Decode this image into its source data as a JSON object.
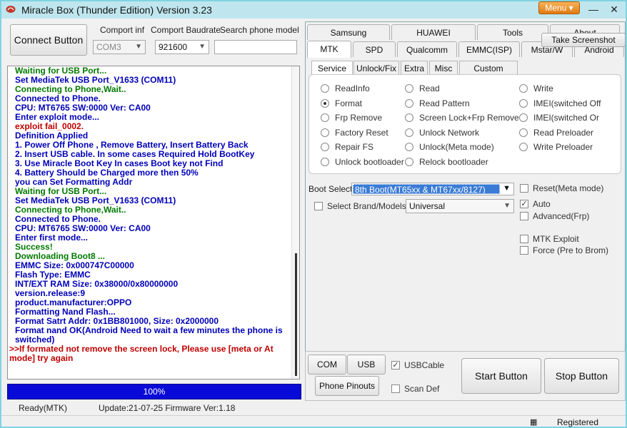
{
  "window": {
    "title": "Miracle Box (Thunder Edition) Version 3.23",
    "menu_label": "Menu",
    "minimize": "—",
    "close": "✕"
  },
  "toolbar": {
    "connect_label": "Connect Button",
    "comport_label": "Comport inf",
    "comport_value": "COM3",
    "baudrate_label": "Comport Baudrate",
    "baudrate_value": "921600",
    "search_label": "Search phone model",
    "search_value": ""
  },
  "log": {
    "colors": {
      "blue": "#0000b8",
      "green": "#007a00",
      "red": "#c00000"
    },
    "lines": [
      {
        "text": "Waiting for USB Port...",
        "color": "green"
      },
      {
        "text": "Set MediaTek USB Port_V1633 (COM11)",
        "color": "blue"
      },
      {
        "text": "Connecting to Phone,Wait..",
        "color": "green"
      },
      {
        "text": "Connected to Phone.",
        "color": "blue"
      },
      {
        "text": "CPU: MT6765 SW:0000 Ver: CA00",
        "color": "blue"
      },
      {
        "text": "Enter exploit mode...",
        "color": "blue"
      },
      {
        "text": "exploit fail_0002.",
        "color": "red"
      },
      {
        "text": "Definition Applied",
        "color": "blue"
      },
      {
        "text": "1. Power Off Phone , Remove Battery, Insert Battery Back",
        "color": "blue"
      },
      {
        "text": "2. Insert USB cable. In some cases Required Hold BootKey",
        "color": "blue"
      },
      {
        "text": "3. Use Miracle Boot Key In cases Boot key not Find",
        "color": "blue"
      },
      {
        "text": "4. Battery Should be Charged more then 50%",
        "color": "blue"
      },
      {
        "text": "you can Set Formatting Addr",
        "color": "blue"
      },
      {
        "text": "Waiting for USB Port...",
        "color": "green"
      },
      {
        "text": "Set MediaTek USB Port_V1633 (COM11)",
        "color": "blue"
      },
      {
        "text": "Connecting to Phone,Wait..",
        "color": "green"
      },
      {
        "text": "Connected to Phone.",
        "color": "blue"
      },
      {
        "text": "CPU: MT6765 SW:0000 Ver: CA00",
        "color": "blue"
      },
      {
        "text": "Enter first mode...",
        "color": "blue"
      },
      {
        "text": "Success!",
        "color": "green"
      },
      {
        "text": "Downloading Boot8 ...",
        "color": "green"
      },
      {
        "text": "EMMC Size: 0x000747C00000",
        "color": "blue"
      },
      {
        "text": "Flash Type: EMMC",
        "color": "blue"
      },
      {
        "text": "INT/EXT RAM  Size: 0x38000/0x80000000",
        "color": "blue"
      },
      {
        "text": "version.release:9",
        "color": "blue"
      },
      {
        "text": "product.manufacturer:OPPO",
        "color": "blue"
      },
      {
        "text": "Formatting Nand Flash...",
        "color": "blue"
      },
      {
        "text": "Format Satrt Addr: 0x1BB801000, Size: 0x2000000",
        "color": "blue"
      },
      {
        "text": "Format nand OK(Android Need to wait a few minutes the phone is switched)",
        "color": "blue",
        "wrap": true,
        "indent": true
      },
      {
        "text": ">>If formated not remove the screen lock, Please use [meta or At mode] try again",
        "color": "red",
        "wrap": true
      }
    ]
  },
  "progress": {
    "label": "100%",
    "fraction": 1.0
  },
  "status": {
    "mode": "Ready(MTK)",
    "update": "Update:21-07-25 Firmware Ver:1.18",
    "registered": "Registered"
  },
  "tabs_row1": [
    "Samsung",
    "HUAWEI",
    "Tools",
    "About"
  ],
  "tabs_row2": [
    "MTK",
    "SPD",
    "Qualcomm",
    "EMMC(ISP)",
    "Mstar/W",
    "Android"
  ],
  "take_screenshot": "Take Screenshot",
  "subtabs": [
    "Service",
    "Unlock/Fix",
    "Extra",
    "Misc",
    "Custom Setting"
  ],
  "radios": {
    "col1": [
      "ReadInfo",
      "Format",
      "Frp Remove",
      "Factory Reset",
      "Repair FS",
      "Unlock bootloader"
    ],
    "col2": [
      "Read",
      "Read Pattern",
      "Screen Lock+Frp Remove",
      "Unlock Network",
      "Unlock(Meta mode)",
      "Relock bootloader"
    ],
    "col3": [
      "Write",
      "IMEI(switched Off",
      "IMEI(switched Or",
      "Read Preloader",
      "Write Preloader"
    ],
    "selected": "Format"
  },
  "boot": {
    "label": "Boot Select:",
    "value": "8th Boot(MT65xx & MT67xx/8127)"
  },
  "brand": {
    "label": "Select Brand/Models",
    "value": "Universal"
  },
  "options": [
    {
      "label": "Reset(Meta mode)",
      "checked": false
    },
    {
      "label": "Auto",
      "checked": true
    },
    {
      "label": "Advanced(Frp)",
      "checked": false
    },
    {
      "label": "MTK Exploit",
      "checked": false
    },
    {
      "label": "Force (Pre to Brom)",
      "checked": false
    }
  ],
  "bottom": {
    "com_scan": "COM Scan",
    "usb_scan": "USB Scan",
    "usb_cable": "USBCable",
    "usb_cable_checked": true,
    "phone_pinouts": "Phone Pinouts",
    "scan_def": "Scan Def",
    "scan_def_checked": false,
    "start": "Start Button",
    "stop": "Stop Button"
  }
}
